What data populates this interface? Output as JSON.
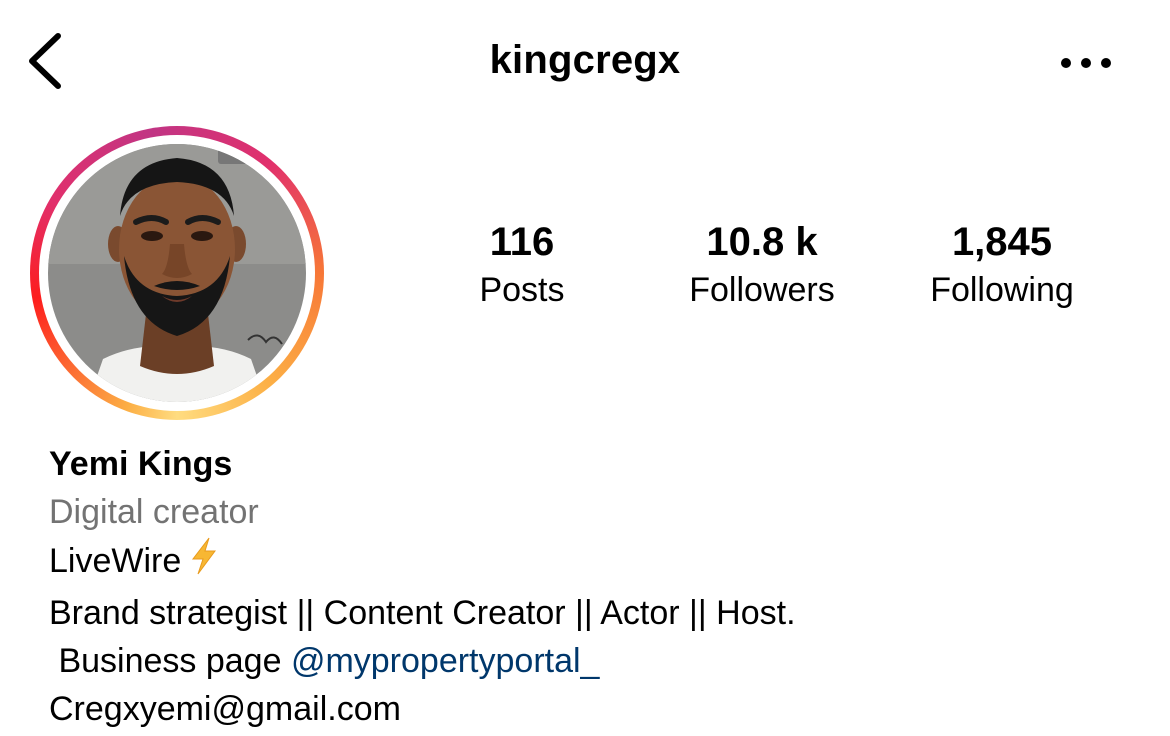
{
  "header": {
    "username": "kingcregx",
    "back_icon": "chevron-left-icon",
    "more_icon": "ellipsis-horizontal-icon"
  },
  "profile": {
    "avatar_alt": "Profile picture",
    "stats": [
      {
        "value": "116",
        "label": "Posts"
      },
      {
        "value": "10.8 k",
        "label": "Followers"
      },
      {
        "value": "1,845",
        "label": "Following"
      }
    ]
  },
  "bio": {
    "name": "Yemi Kings",
    "category": "Digital creator",
    "line1": "LiveWire",
    "line1_icon": "lightning-bolt-icon",
    "line2": "Brand strategist || Content Creator || Actor || Host.",
    "line3_prefix": " Business page ",
    "line3_mention": "@mypropertyportal_",
    "email": "Cregxyemi@gmail.com"
  },
  "colors": {
    "text": "#000000",
    "secondary_text": "#737373",
    "mention": "#00376b",
    "bolt": "#f7b733",
    "story_ring_start": "#fcaf45",
    "story_ring_end": "#c13584"
  }
}
